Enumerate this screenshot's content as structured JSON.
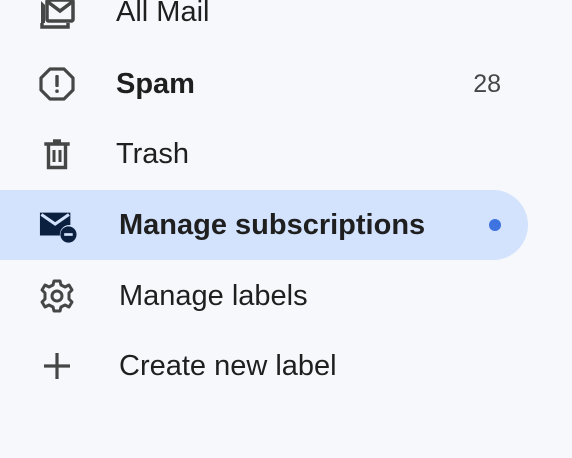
{
  "nav": {
    "all_mail": {
      "label": "All Mail",
      "icon": "all-mail-icon"
    },
    "spam": {
      "label": "Spam",
      "count": "28",
      "icon": "spam-icon"
    },
    "trash": {
      "label": "Trash",
      "icon": "trash-icon"
    },
    "manage_subscriptions": {
      "label": "Manage subscriptions",
      "icon": "manage-subscriptions-icon",
      "unread_dot_color": "#3f73e0",
      "active_bg": "#d3e3fd"
    },
    "manage_labels": {
      "label": "Manage labels",
      "icon": "gear-icon"
    },
    "create_label": {
      "label": "Create new label",
      "icon": "plus-icon"
    }
  }
}
